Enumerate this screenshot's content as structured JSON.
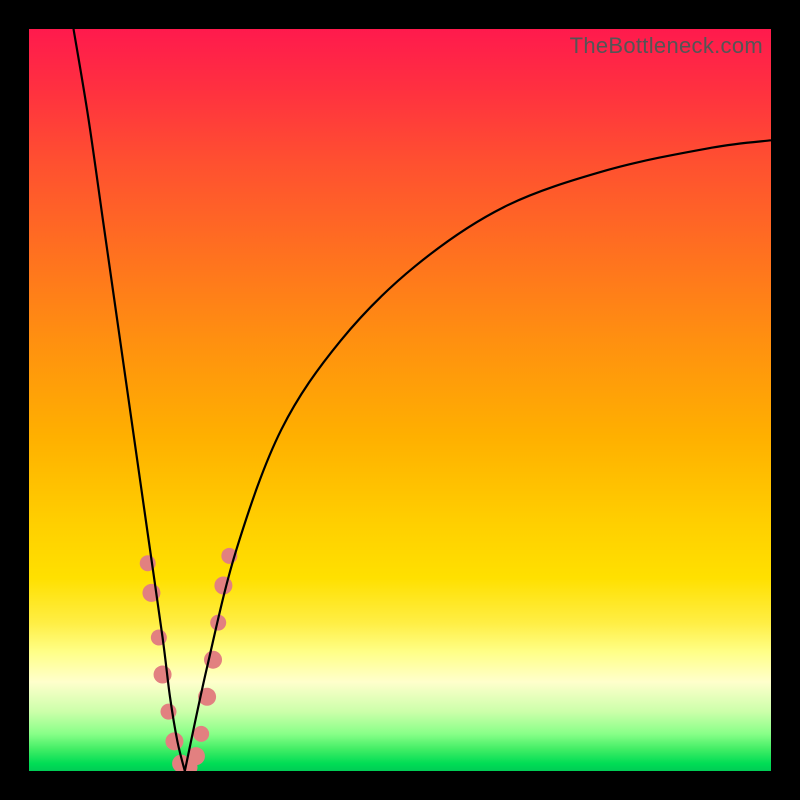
{
  "watermark": "TheBottleneck.com",
  "chart_data": {
    "type": "line",
    "title": "",
    "xlabel": "",
    "ylabel": "",
    "xlim": [
      0,
      100
    ],
    "ylim": [
      0,
      100
    ],
    "background_gradient": {
      "top_color": "#ff1a4d",
      "bottom_color": "#00cc55",
      "stops": [
        {
          "pos": 0,
          "color": "#ff1a4d"
        },
        {
          "pos": 50,
          "color": "#ffb000"
        },
        {
          "pos": 85,
          "color": "#ffff88"
        },
        {
          "pos": 100,
          "color": "#00cc55"
        }
      ]
    },
    "series": [
      {
        "name": "left-branch",
        "description": "Steep descending curve from top-left toward minimum",
        "x": [
          6,
          8,
          10,
          12,
          14,
          16,
          18,
          19,
          20,
          21
        ],
        "y": [
          100,
          88,
          74,
          60,
          46,
          32,
          18,
          10,
          4,
          0
        ]
      },
      {
        "name": "right-branch",
        "description": "Curve rising from minimum asymptotically toward upper right",
        "x": [
          21,
          24,
          28,
          34,
          42,
          52,
          64,
          78,
          92,
          100
        ],
        "y": [
          0,
          14,
          30,
          46,
          58,
          68,
          76,
          81,
          84,
          85
        ]
      }
    ],
    "minimum_x": 21,
    "dot_cluster": {
      "description": "Salmon-colored data point markers concentrated near curve minimum",
      "color": "#e28080",
      "points": [
        {
          "x": 16.0,
          "y": 28,
          "r": 8
        },
        {
          "x": 16.5,
          "y": 24,
          "r": 9
        },
        {
          "x": 17.5,
          "y": 18,
          "r": 8
        },
        {
          "x": 18.0,
          "y": 13,
          "r": 9
        },
        {
          "x": 18.8,
          "y": 8,
          "r": 8
        },
        {
          "x": 19.6,
          "y": 4,
          "r": 9
        },
        {
          "x": 20.5,
          "y": 1,
          "r": 9
        },
        {
          "x": 21.5,
          "y": 0.5,
          "r": 9
        },
        {
          "x": 22.5,
          "y": 2,
          "r": 9
        },
        {
          "x": 23.2,
          "y": 5,
          "r": 8
        },
        {
          "x": 24.0,
          "y": 10,
          "r": 9
        },
        {
          "x": 24.8,
          "y": 15,
          "r": 9
        },
        {
          "x": 25.5,
          "y": 20,
          "r": 8
        },
        {
          "x": 26.2,
          "y": 25,
          "r": 9
        },
        {
          "x": 27.0,
          "y": 29,
          "r": 8
        }
      ]
    }
  }
}
